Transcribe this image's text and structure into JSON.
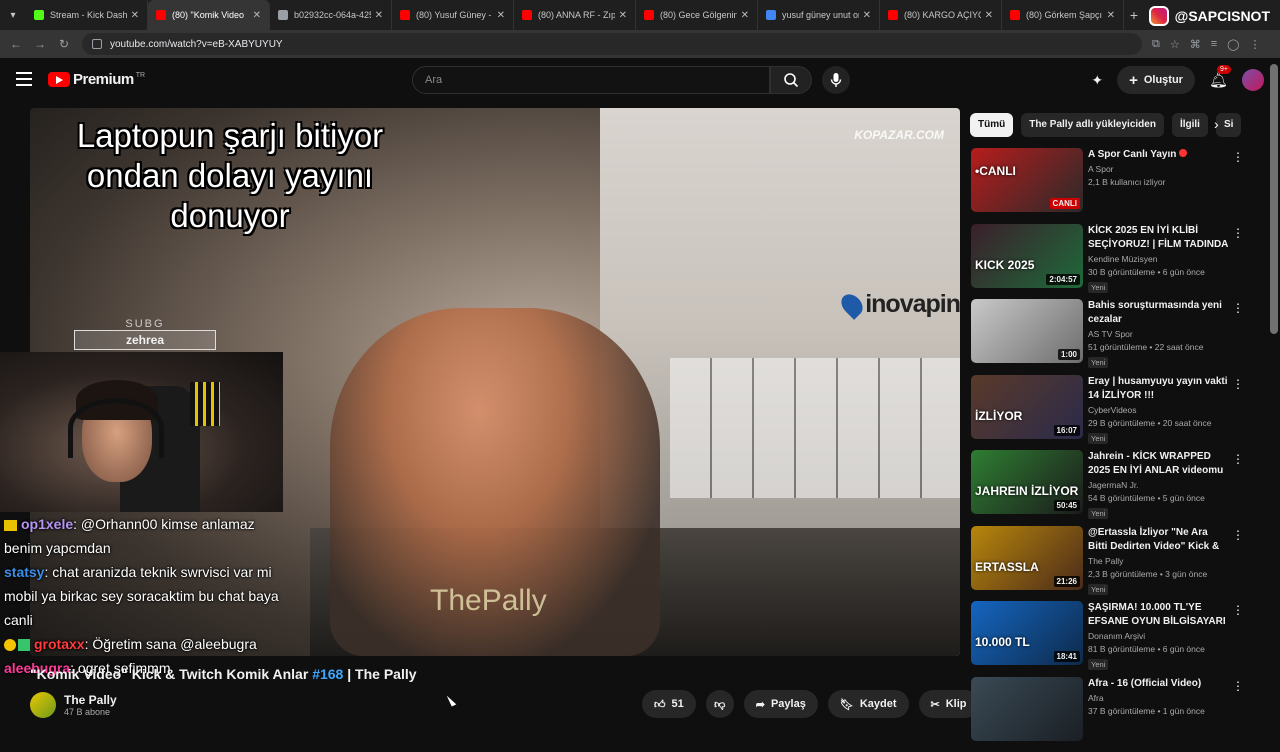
{
  "browser": {
    "tabs": [
      {
        "title": "Stream - Kick Dashbo",
        "color": "#53fc18",
        "active": false
      },
      {
        "title": "(80) \"Komik Video",
        "color": "#ff0000",
        "active": true
      },
      {
        "title": "b02932cc-064a-4259",
        "color": "#9aa0a6",
        "active": false
      },
      {
        "title": "(80) Yusuf Güney - U",
        "color": "#ff0000",
        "active": false
      },
      {
        "title": "(80) ANNA RF - Zıpla",
        "color": "#ff0000",
        "active": false
      },
      {
        "title": "(80) Gece Gölgenin R",
        "color": "#ff0000",
        "active": false
      },
      {
        "title": "yusuf güney unut ons",
        "color": "#4285f4",
        "active": false
      },
      {
        "title": "(80) KARGO AÇIYORU",
        "color": "#ff0000",
        "active": false
      },
      {
        "title": "(80) Görkem Şapçı -",
        "color": "#ff0000",
        "active": false
      }
    ],
    "url": "youtube.com/watch?v=eB-XABYUYUY",
    "overlay_handle": "@SAPCISNOT"
  },
  "header": {
    "logo_text": "Premium",
    "logo_cc": "TR",
    "search_placeholder": "Ara",
    "create_label": "Oluştur",
    "notif_count": "9+"
  },
  "video": {
    "caption": "Laptopun şarjı bitiyor ondan dolayı yayını donuyor",
    "sponsor1": "KOPAZAR.COM",
    "sponsor2": "inovapin",
    "watermark": "ThePally",
    "sub_label": "SUBG",
    "sub_name": "zehrea",
    "title_pre": "\"Komik Video\" Kick & Twitch Komik Anlar ",
    "title_hash": "#168",
    "title_post": " | The Pally",
    "channel": "The Pally",
    "channel_subs": "47 B abone"
  },
  "chat": [
    {
      "user": "op1xele",
      "user_color": "#b794f6",
      "text": ": @Orhann00 kimse anlamaz benim yapcmdan",
      "badge": "crown"
    },
    {
      "user": "statsy",
      "user_color": "#3b8eea",
      "text": ": chat aranizda teknik swrvisci var mi mobil ya birkac sey soracaktim bu chat baya canli",
      "badge": "none"
    },
    {
      "user": "grotaxx",
      "user_color": "#ff3b3b",
      "text": ": Öğretim sana @aleebugra",
      "badge": "double"
    },
    {
      "user": "aleebugra",
      "user_color": "#ff3b9a",
      "text": ": ogret şefimmm",
      "badge": "none"
    }
  ],
  "actions": {
    "likes": "51",
    "share": "Paylaş",
    "save": "Kaydet",
    "clip": "Klip"
  },
  "chips": [
    "Tümü",
    "The Pally adlı yükleyiciden",
    "İlgili",
    "Si"
  ],
  "recommendations": [
    {
      "title": "A Spor Canlı Yayın",
      "channel": "A Spor",
      "meta": "2,1 B kullanıcı izliyor",
      "duration": "CANLI",
      "live": true,
      "new": false,
      "thumb_text": "•CANLI",
      "thumb_colors": [
        "#b71c1c",
        "#2a2a2a"
      ]
    },
    {
      "title": "KİCK 2025 EN İYİ KLİBİ SEÇİYORUZ! | FİLM TADINDA ...",
      "channel": "Kendine Müzisyen",
      "meta": "30 B görüntüleme • 6 gün önce",
      "duration": "2:04:57",
      "live": false,
      "new": true,
      "thumb_text": "KICK 2025",
      "thumb_colors": [
        "#3b1f2b",
        "#1e6a3a"
      ]
    },
    {
      "title": "Bahis soruşturmasında yeni cezalar",
      "channel": "AS TV Spor",
      "meta": "51 görüntüleme • 22 saat önce",
      "duration": "1:00",
      "live": false,
      "new": true,
      "thumb_text": "",
      "thumb_colors": [
        "#c9c9c9",
        "#6d6d6d"
      ]
    },
    {
      "title": "Eray | husamyuyu yayın vakti 14 İZLİYOR !!!",
      "channel": "CyberVideos",
      "meta": "29 B görüntüleme • 20 saat önce",
      "duration": "16:07",
      "live": false,
      "new": true,
      "thumb_text": "İZLİYOR",
      "thumb_colors": [
        "#5a3a2a",
        "#2a2a4a"
      ]
    },
    {
      "title": "Jahrein - KİCK WRAPPED 2025 EN İYİ ANLAR videomu izliyor",
      "channel": "JagermaN Jr.",
      "meta": "54 B görüntüleme • 5 gün önce",
      "duration": "50:45",
      "live": false,
      "new": true,
      "thumb_text": "JAHREIN İZLİYOR",
      "thumb_colors": [
        "#2e7d32",
        "#1b1b1b"
      ]
    },
    {
      "title": "@Ertassla İzliyor \"Ne Ara Bitti Dedirten Video\" Kick & Twitch ...",
      "channel": "The Pally",
      "meta": "2,3 B görüntüleme • 3 gün önce",
      "duration": "21:26",
      "live": false,
      "new": true,
      "thumb_text": "ERTASSLA",
      "thumb_colors": [
        "#b8860b",
        "#4a2a1a"
      ]
    },
    {
      "title": "ŞAŞIRMA! 10.000 TL'YE EFSANE OYUN BİLGİSAYARI ...",
      "channel": "Donanım Arşivi",
      "meta": "81 B görüntüleme • 6 gün önce",
      "duration": "18:41",
      "live": false,
      "new": true,
      "thumb_text": "10.000 TL",
      "thumb_colors": [
        "#1565c0",
        "#0d2a4a"
      ]
    },
    {
      "title": "Afra - 16 (Official Video)",
      "channel": "Afra",
      "meta": "37 B görüntüleme • 1 gün önce",
      "duration": "",
      "live": false,
      "new": false,
      "thumb_text": "",
      "thumb_colors": [
        "#3a4a55",
        "#1a1f24"
      ]
    }
  ]
}
